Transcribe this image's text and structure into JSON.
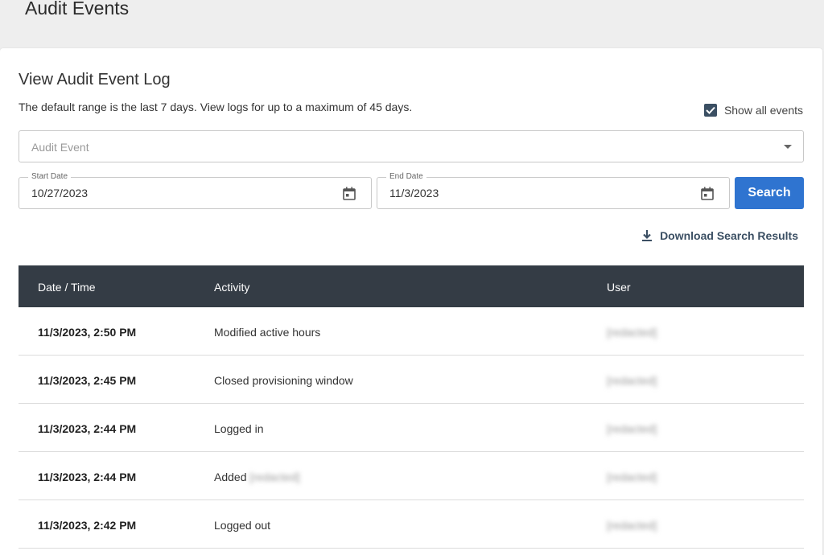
{
  "header": {
    "title": "Audit Events"
  },
  "card": {
    "title": "View Audit Event Log",
    "description": "The default range is the last 7 days. View logs for up to a maximum of 45 days.",
    "show_all_label": "Show all events",
    "show_all_checked": true
  },
  "filters": {
    "audit_event_placeholder": "Audit Event",
    "start_date_label": "Start Date",
    "start_date_value": "10/27/2023",
    "end_date_label": "End Date",
    "end_date_value": "11/3/2023",
    "search_label": "Search"
  },
  "download_label": "Download Search Results",
  "table": {
    "columns": [
      "Date / Time",
      "Activity",
      "User"
    ],
    "rows": [
      {
        "datetime": "11/3/2023, 2:50 PM",
        "activity": "Modified active hours",
        "activity_redacted": "",
        "user": "[redacted]"
      },
      {
        "datetime": "11/3/2023, 2:45 PM",
        "activity": "Closed provisioning window",
        "activity_redacted": "",
        "user": "[redacted]"
      },
      {
        "datetime": "11/3/2023, 2:44 PM",
        "activity": "Logged in",
        "activity_redacted": "",
        "user": "[redacted]"
      },
      {
        "datetime": "11/3/2023, 2:44 PM",
        "activity": "Added",
        "activity_redacted": "[redacted]",
        "user": "[redacted]"
      },
      {
        "datetime": "11/3/2023, 2:42 PM",
        "activity": "Logged out",
        "activity_redacted": "",
        "user": "[redacted]"
      }
    ]
  },
  "colors": {
    "accent": "#2f74d0",
    "table_header": "#343c45",
    "checkbox": "#3b4f63"
  }
}
